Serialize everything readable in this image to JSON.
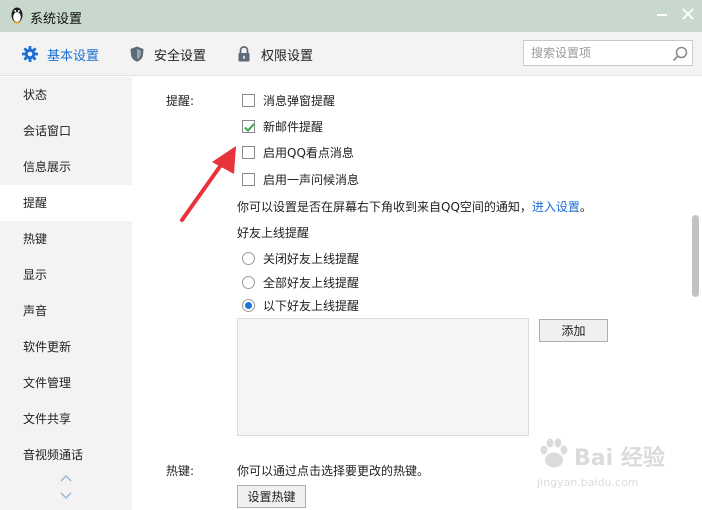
{
  "window": {
    "title": "系统设置"
  },
  "tabs": [
    {
      "label": "基本设置",
      "active": true,
      "icon": "gear-icon"
    },
    {
      "label": "安全设置",
      "active": false,
      "icon": "shield-icon"
    },
    {
      "label": "权限设置",
      "active": false,
      "icon": "lock-icon"
    }
  ],
  "search": {
    "placeholder": "搜索设置项",
    "value": ""
  },
  "sidebar": {
    "items": [
      {
        "label": "状态",
        "active": false
      },
      {
        "label": "会话窗口",
        "active": false
      },
      {
        "label": "信息展示",
        "active": false
      },
      {
        "label": "提醒",
        "active": true
      },
      {
        "label": "热键",
        "active": false
      },
      {
        "label": "显示",
        "active": false
      },
      {
        "label": "声音",
        "active": false
      },
      {
        "label": "软件更新",
        "active": false
      },
      {
        "label": "文件管理",
        "active": false
      },
      {
        "label": "文件共享",
        "active": false
      },
      {
        "label": "音视频通话",
        "active": false
      }
    ]
  },
  "reminder": {
    "section_label": "提醒:",
    "options": [
      {
        "label": "消息弹窗提醒",
        "checked": false
      },
      {
        "label": "新邮件提醒",
        "checked": true
      },
      {
        "label": "启用QQ看点消息",
        "checked": false
      },
      {
        "label": "启用一声问候消息",
        "checked": false
      }
    ],
    "hint_text": "你可以设置是否在屏幕右下角收到来自QQ空间的通知，",
    "hint_link": "进入设置",
    "hint_end": "。",
    "friend_online_title": "好友上线提醒",
    "friend_options": [
      {
        "label": "关闭好友上线提醒",
        "selected": false
      },
      {
        "label": "全部好友上线提醒",
        "selected": false
      },
      {
        "label": "以下好友上线提醒",
        "selected": true
      }
    ],
    "add_button": "添加"
  },
  "hotkey": {
    "section_label": "热键:",
    "hint": "你可以通过点击选择要更改的热键。",
    "button": "设置热键"
  },
  "watermark": {
    "text": "Bai 经验",
    "sub": "jingyan.baidu.com"
  },
  "colors": {
    "accent": "#1a6fd0",
    "check": "#3aa64a",
    "arrow": "#e8333b",
    "titlebar": "#c8d8cc"
  }
}
